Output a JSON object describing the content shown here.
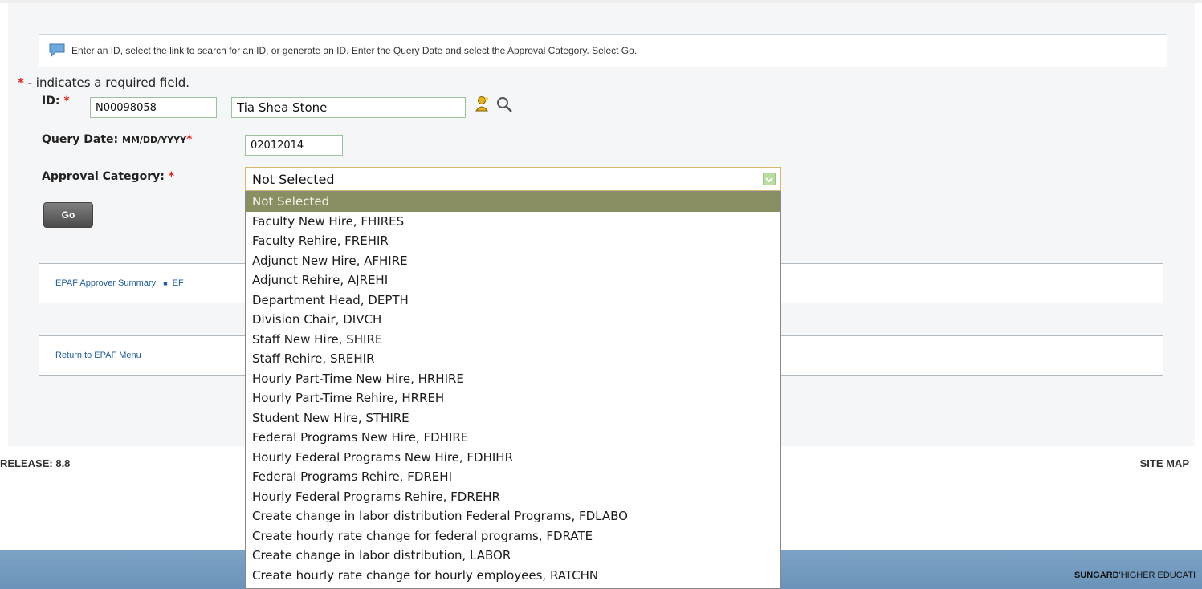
{
  "instructions": "Enter an ID, select the link to search for an ID, or generate an ID. Enter the Query Date and select the Approval Category. Select Go.",
  "required_note": {
    "star": "*",
    "text": " - indicates a required field."
  },
  "form": {
    "id_label": "ID:",
    "id_value": "N00098058",
    "name_value": "Tia Shea Stone",
    "query_date_label": "Query Date:",
    "query_date_format": "MM/DD/YYYY",
    "query_date_value": "02012014",
    "approval_label": "Approval Category:",
    "approval_selected": "Not Selected",
    "go_label": "Go",
    "star": "*"
  },
  "dropdown_options": [
    "Not Selected",
    "Faculty New Hire, FHIRES",
    "Faculty Rehire, FREHIR",
    "Adjunct New Hire, AFHIRE",
    "Adjunct Rehire, AJREHI",
    "Department Head, DEPTH",
    "Division Chair, DIVCH",
    "Staff New Hire, SHIRE",
    "Staff Rehire, SREHIR",
    "Hourly Part-Time New Hire, HRHIRE",
    "Hourly Part-Time Rehire, HRREH",
    "Student New Hire, STHIRE",
    "Federal Programs New Hire, FDHIRE",
    "Hourly Federal Programs New Hire, FDHIHR",
    "Federal Programs Rehire, FDREHI",
    "Hourly Federal Programs Rehire, FDREHR",
    "Create change in labor distribution Federal Programs, FDLABO",
    "Create hourly rate change for federal programs, FDRATE",
    "Create change in labor distribution, LABOR",
    "Create hourly rate change for hourly employees, RATCHN"
  ],
  "links": {
    "approver_summary": "EPAF Approver Summary",
    "separator": "■",
    "partial_link": "EF",
    "return_menu": "Return to EPAF Menu"
  },
  "footer": {
    "release": "RELEASE: 8.8",
    "site_map": "SITE MAP",
    "brand_bold": "SUNGARD",
    "brand_rest": "'HIGHER EDUCATI"
  },
  "colors": {
    "selected_option_bg": "#8a8f63",
    "required_star": "#e2231a",
    "footer_bar": "#7da3c6",
    "link": "#1e5c9a"
  },
  "icons": [
    "info-comment-icon",
    "person-icon",
    "search-icon",
    "dropdown-arrow-icon"
  ]
}
